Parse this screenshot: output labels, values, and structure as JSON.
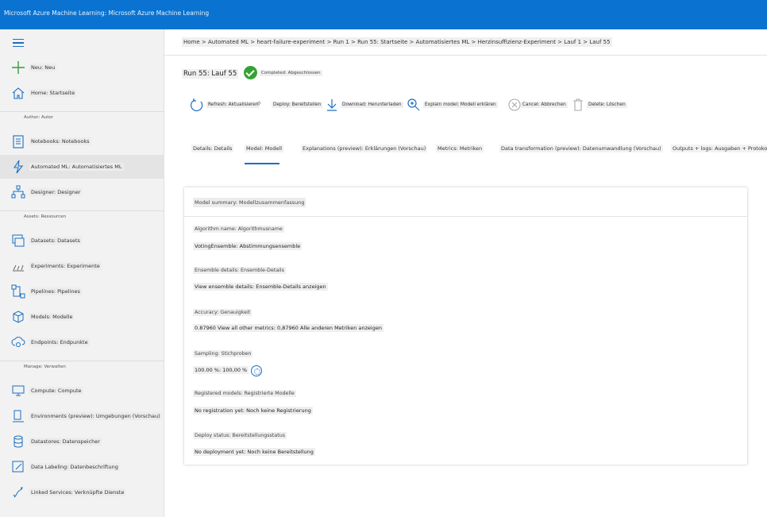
{
  "window": {
    "title": "Microsoft Azure Machine Learning: Microsoft Azure Machine Learning"
  },
  "sidebar": {
    "new_label": "Neu: Neu",
    "home_label": "Home: Startseite",
    "section_author": "Author: Autor",
    "notebooks_label": "Notebooks: Notebooks",
    "automl_label": "Automated ML: Automatisiertes ML",
    "designer_label": "Designer: Designer",
    "section_assets": "Assets: Ressourcen",
    "datasets_label": "Datasets: Datasets",
    "experiments_label": "Experiments: Experimente",
    "pipelines_label": "Pipelines: Pipelines",
    "models_label": "Models: Modelle",
    "endpoints_label": "Endpoints: Endpunkte",
    "section_manage": "Manage: Verwalten",
    "compute_label": "Compute: Compute",
    "environments_label": "Environments (preview): Umgebungen (Vorschau)",
    "datastores_label": "Datastores: Datenspeicher",
    "labeling_label": "Data Labeling: Datenbeschriftung",
    "linked_label": "Linked Services: Verknüpfte Dienste"
  },
  "main": {
    "breadcrumb": "Home > Automated ML > heart-failure-experiment > Run 1 > Run 55: Startseite > Automatisiertes ML > Herzinsuffizienz-Experiment > Lauf 1 > Lauf 55",
    "run_title": "Run 55: Lauf 55",
    "status_text": "Completed: Abgeschlossen",
    "toolbar": {
      "refresh": "Refresh: Aktualisieren",
      "deploy": "Deploy: Bereitstellen",
      "download": "Download: Herunterladen",
      "explain": "Explain model: Modell erklären",
      "cancel": "Cancel: Abbrechen",
      "delete": "Delete: Löschen"
    },
    "tabs": {
      "details": "Details: Details",
      "model": "Model: Modell",
      "explanations": "Explanations (preview): Erklärungen (Vorschau)",
      "metrics": "Metrics: Metriken",
      "data_transformation": "Data transformation (preview): Datenumwandlung (Vorschau)",
      "outputs": "Outputs + logs: Ausgaben + Protokolle"
    },
    "card": {
      "header": "Model summary: Modellzusammenfassung",
      "algo_label": "Algorithm name: Algorithmusname",
      "algo_value": "VotingEnsemble: Abstimmungsensemble",
      "ensemble_label": "Ensemble details: Ensemble-Details",
      "ensemble_value": "View ensemble details: Ensemble-Details anzeigen",
      "accuracy_label": "Accuracy: Genauigkeit",
      "accuracy_value": "0.87960 View all other metrics: 0,87960 Alle anderen Metriken anzeigen",
      "sampling_label": "Sampling: Stichproben",
      "sampling_value": "100.00 %: 100,00 %",
      "registered_label": "Registered models: Registrierte Modelle",
      "registered_value": "No registration yet: Noch keine Registrierung",
      "deploy_label": "Deploy status: Bereitstellungsstatus",
      "deploy_value": "No deployment yet: Noch keine Bereitstellung"
    }
  },
  "colors": {
    "brand_blue": "#0a73d1",
    "success_green": "#36a235",
    "accent": "#1a6fc2"
  }
}
